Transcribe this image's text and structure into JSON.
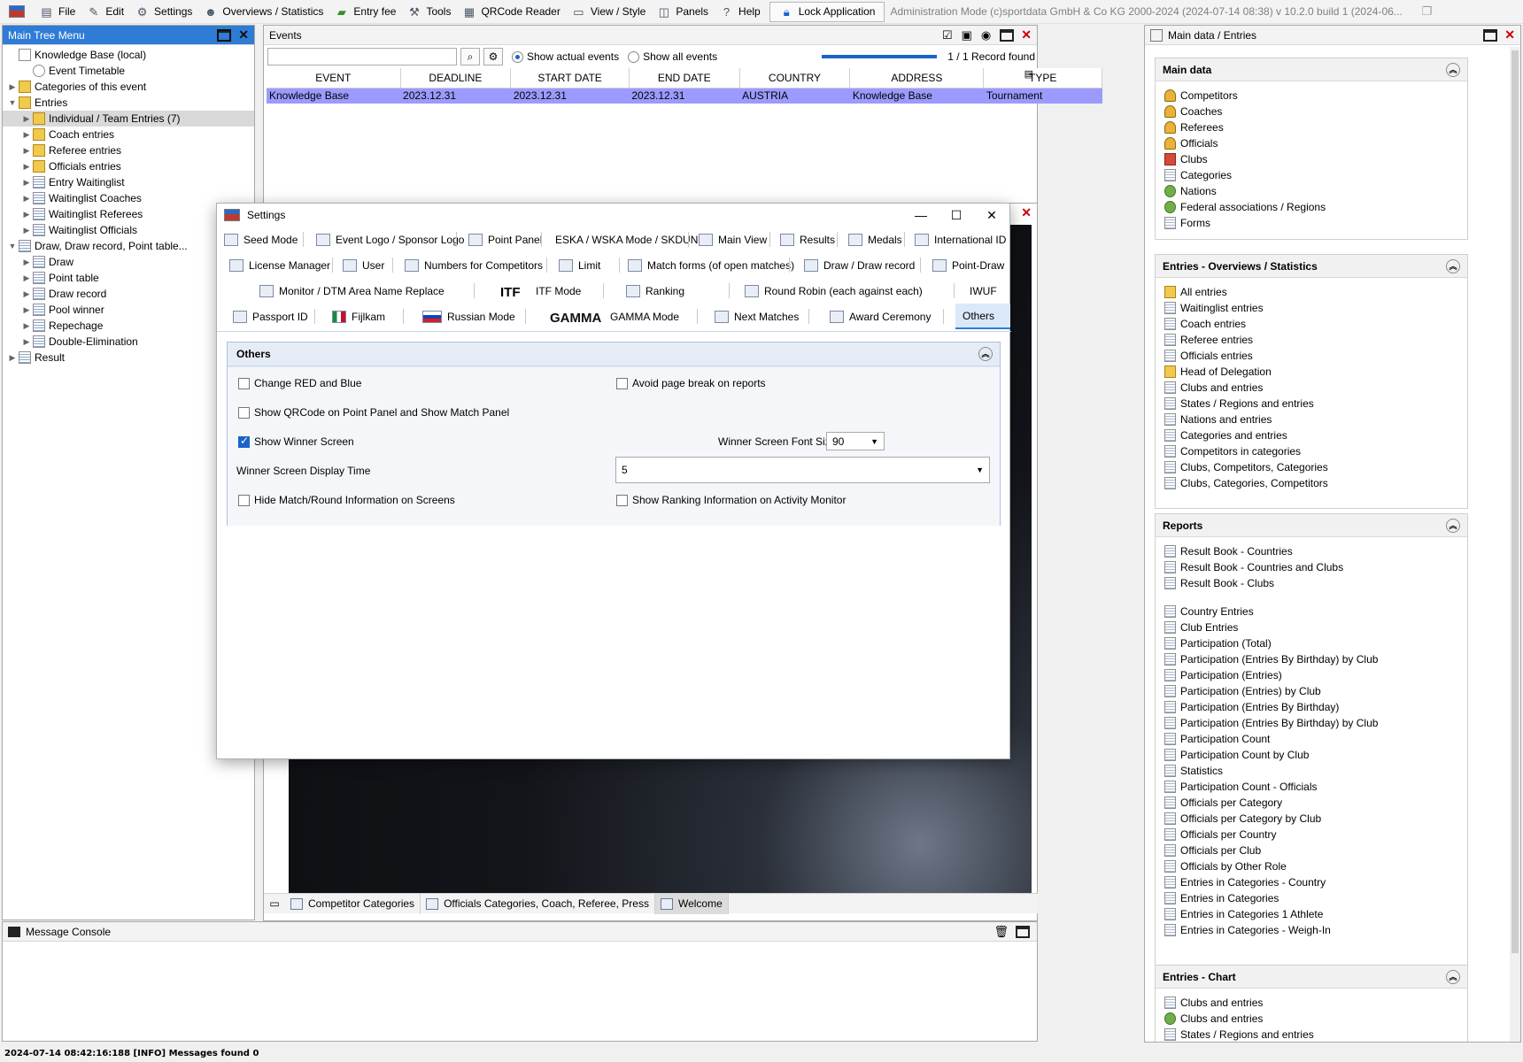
{
  "menubar": {
    "items": [
      {
        "label": "File",
        "icon": "file-icon"
      },
      {
        "label": "Edit",
        "icon": "edit-icon"
      },
      {
        "label": "Settings",
        "icon": "gear-icon"
      },
      {
        "label": "Overviews / Statistics",
        "icon": "people-icon"
      },
      {
        "label": "Entry fee",
        "icon": "money-icon"
      },
      {
        "label": "Tools",
        "icon": "wrench-icon"
      },
      {
        "label": "QRCode Reader",
        "icon": "qrcode-icon"
      },
      {
        "label": "View / Style",
        "icon": "window-icon"
      },
      {
        "label": "Panels",
        "icon": "panels-icon"
      },
      {
        "label": "Help",
        "icon": "help-icon"
      }
    ],
    "lock_label": "Lock Application",
    "mode_text": "Administration Mode (c)sportdata GmbH & Co KG 2000-2024 (2024-07-14 08:38)  v 10.2.0 build 1 (2024-06..."
  },
  "tree_panel": {
    "title": "Main Tree Menu",
    "nodes": [
      {
        "label": "Knowledge Base (local)",
        "level": 0
      },
      {
        "label": "Event Timetable",
        "level": 1
      },
      {
        "label": "Categories of this event",
        "level": 0
      },
      {
        "label": "Entries",
        "level": 0
      },
      {
        "label": "Individual / Team Entries (7)",
        "level": 1
      },
      {
        "label": "Coach entries",
        "level": 1
      },
      {
        "label": "Referee entries",
        "level": 1
      },
      {
        "label": "Officials entries",
        "level": 1
      },
      {
        "label": "Entry Waitinglist",
        "level": 1
      },
      {
        "label": "Waitinglist Coaches",
        "level": 1
      },
      {
        "label": "Waitinglist Referees",
        "level": 1
      },
      {
        "label": "Waitinglist Officials",
        "level": 1
      },
      {
        "label": "Draw, Draw record, Point table...",
        "level": 0
      },
      {
        "label": "Draw",
        "level": 1
      },
      {
        "label": "Point table",
        "level": 1
      },
      {
        "label": "Draw record",
        "level": 1
      },
      {
        "label": "Pool winner",
        "level": 1
      },
      {
        "label": "Repechage",
        "level": 1
      },
      {
        "label": "Double-Elimination",
        "level": 1
      },
      {
        "label": "Result",
        "level": 0
      }
    ]
  },
  "events_panel": {
    "title": "Events",
    "search_value": "",
    "radio_actual": "Show actual events",
    "radio_all": "Show all events",
    "record_text": "1 / 1 Record found",
    "columns": [
      "EVENT",
      "DEADLINE",
      "START DATE",
      "END DATE",
      "COUNTRY",
      "ADDRESS",
      "TYPE"
    ],
    "rows": [
      [
        "Knowledge Base",
        "2023.12.31",
        "2023.12.31",
        "2023.12.31",
        "AUSTRIA",
        "Knowledge Base",
        "Tournament"
      ]
    ]
  },
  "settings_dialog": {
    "title": "Settings",
    "ribbon_row1": [
      "Seed Mode",
      "Event Logo / Sponsor Logo",
      "Point Panel",
      "ESKA / WSKA Mode / SKDUN",
      "Main View",
      "Results",
      "Medals",
      "International ID"
    ],
    "ribbon_row2": [
      "License Manager",
      "User",
      "Numbers for Competitors",
      "Limit",
      "Match forms (of open matches)",
      "Draw / Draw record",
      "Point-Draw"
    ],
    "ribbon_row3": [
      "Monitor / DTM Area Name Replace",
      "ITF Mode",
      "Ranking",
      "Round Robin (each against each)",
      "IWUF"
    ],
    "ribbon_row4": [
      "Passport ID",
      "Fijlkam",
      "Russian Mode",
      "GAMMA Mode",
      "Next Matches",
      "Award Ceremony",
      "Others"
    ],
    "itf_logo": "ITF",
    "gamma_logo": "GAMMA",
    "others": {
      "title": "Others",
      "change_red_blue": "Change RED and Blue",
      "avoid_page_break": "Avoid page break on reports",
      "show_qrcode": "Show QRCode on Point Panel and Show Match Panel",
      "show_winner": "Show Winner Screen",
      "winner_font_label": "Winner Screen Font Size",
      "winner_font_value": "90",
      "display_time_label": "Winner Screen Display Time",
      "display_time_value": "5",
      "hide_match_info": "Hide Match/Round Information on Screens",
      "show_ranking_info": "Show Ranking Information on Activity Monitor"
    }
  },
  "bottom_tabs": [
    "Competitor Categories",
    "Officials Categories, Coach, Referee, Press",
    "Welcome"
  ],
  "console": {
    "title": "Message Console"
  },
  "right_panel": {
    "title": "Main data / Entries",
    "main_data": {
      "title": "Main data",
      "items": [
        "Competitors",
        "Coaches",
        "Referees",
        "Officials",
        "Clubs",
        "Categories",
        "Nations",
        "Federal associations / Regions",
        "Forms"
      ]
    },
    "overviews": {
      "title": "Entries - Overviews / Statistics",
      "items": [
        "All entries",
        "Waitinglist entries",
        "Coach entries",
        "Referee entries",
        "Officials entries",
        "Head of Delegation",
        "Clubs and entries",
        "States / Regions and entries",
        "Nations and entries",
        "Categories and entries",
        "Competitors in categories",
        "Clubs, Competitors, Categories",
        "Clubs, Categories, Competitors"
      ]
    },
    "reports": {
      "title": "Reports",
      "items_a": [
        "Result Book - Countries",
        "Result Book - Countries and Clubs",
        "Result Book - Clubs"
      ],
      "items_b": [
        "Country Entries",
        "Club Entries",
        "Participation (Total)",
        "Participation (Entries By Birthday) by Club",
        "Participation (Entries)",
        "Participation (Entries) by Club",
        "Participation (Entries By Birthday)",
        "Participation (Entries By Birthday) by Club",
        "Participation Count",
        "Participation Count by Club",
        "Statistics",
        "Participation Count - Officials",
        "Officials per Category",
        "Officials per Category by Club",
        "Officials per Country",
        "Officials per Club",
        "Officials by Other Role",
        "Entries in Categories - Country",
        "Entries in Categories",
        "Entries in Categories 1 Athlete",
        "Entries in Categories - Weigh-In"
      ]
    },
    "chart": {
      "title": "Entries - Chart",
      "items": [
        "Clubs and entries",
        "Clubs and entries",
        "States / Regions and entries"
      ]
    }
  },
  "status_bar": {
    "text": "2024-07-14 08:42:16:188 [INFO] Messages found 0"
  }
}
